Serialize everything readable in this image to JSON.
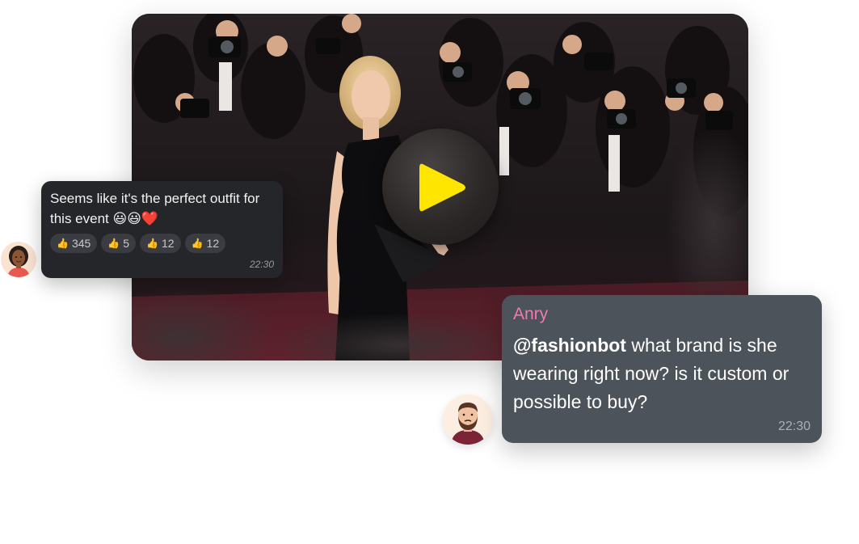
{
  "video": {
    "play_icon": "play-icon",
    "accent_color": "#FFE600"
  },
  "left_message": {
    "text": "Seems like it's the perfect outfit for this event 😃😃❤️",
    "reactions": [
      {
        "icon": "thumbs-up-icon",
        "glyph": "👍",
        "count": "345"
      },
      {
        "icon": "thumbs-up-icon",
        "glyph": "👍",
        "count": "5"
      },
      {
        "icon": "thumbs-up-icon",
        "glyph": "👍",
        "count": "12"
      },
      {
        "icon": "thumbs-up-icon",
        "glyph": "👍",
        "count": "12"
      }
    ],
    "time": "22:30",
    "bubble_color": "#25262A"
  },
  "right_message": {
    "sender": "Anry",
    "mention": "@fashionbot",
    "text": " what brand is she wearing right now? is it custom or possible to buy?",
    "time": "22:30",
    "bubble_color": "#4C535A",
    "sender_color": "#F07AB0"
  }
}
